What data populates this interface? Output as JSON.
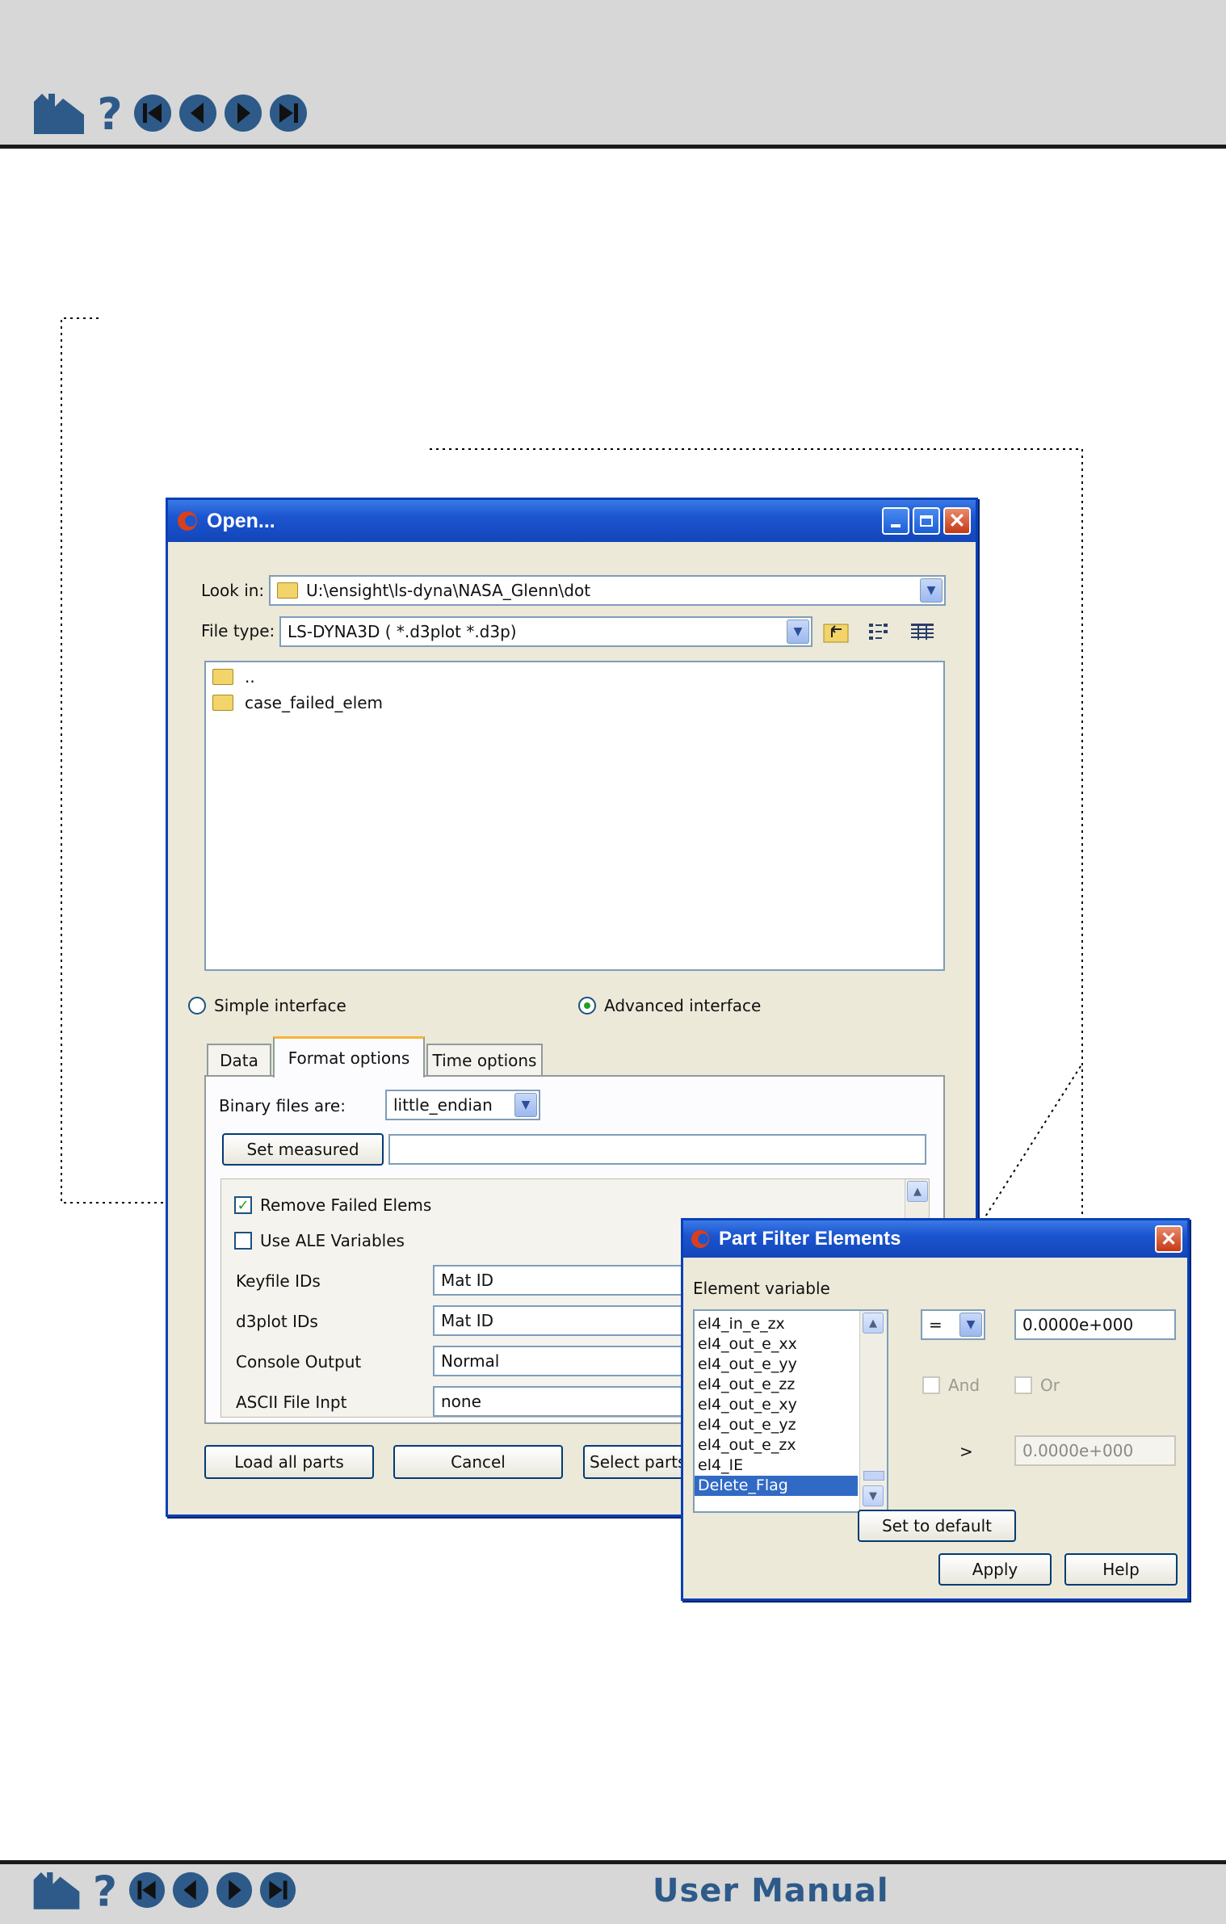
{
  "colors": {
    "bar": "#d7d7d7",
    "accent": "#2d5a88",
    "titlebar": "#1c55d0",
    "selection": "#316ac5",
    "check": "#21a121"
  },
  "nav": {
    "icons": [
      "home-icon",
      "help-icon",
      "first-page-icon",
      "prev-page-icon",
      "next-page-icon",
      "last-page-icon"
    ]
  },
  "footer": {
    "title": "User Manual"
  },
  "open_dialog": {
    "title": "Open...",
    "look_in_label": "Look in:",
    "look_in_value": "U:\\ensight\\ls-dyna\\NASA_Glenn\\dot",
    "file_type_label": "File type:",
    "file_type_value": "LS-DYNA3D ( *.d3plot *.d3p)",
    "files": [
      "..",
      "case_failed_elem"
    ],
    "simple_interface": "Simple interface",
    "advanced_interface": "Advanced interface",
    "tabs": [
      "Data",
      "Format options",
      "Time options"
    ],
    "binary_label": "Binary files are:",
    "binary_value": "little_endian",
    "set_measured": "Set measured",
    "measured_value": "",
    "remove_failed": "Remove Failed Elems",
    "use_ale": "Use ALE Variables",
    "options": [
      {
        "label": "Keyfile IDs",
        "value": "Mat ID"
      },
      {
        "label": "d3plot IDs",
        "value": "Mat ID"
      },
      {
        "label": "Console Output",
        "value": "Normal"
      },
      {
        "label": "ASCII File Inpt",
        "value": "none"
      }
    ],
    "load_all": "Load all parts",
    "cancel": "Cancel",
    "select_parts": "Select parts t"
  },
  "filter_dialog": {
    "title": "Part Filter Elements",
    "element_variable_label": "Element variable",
    "variables": [
      "el4_in_e_zx",
      "el4_out_e_xx",
      "el4_out_e_yy",
      "el4_out_e_zz",
      "el4_out_e_xy",
      "el4_out_e_yz",
      "el4_out_e_zx",
      "el4_IE",
      "Delete_Flag"
    ],
    "selected_variable": "Delete_Flag",
    "operator": "=",
    "value": "0.0000e+000",
    "and_label": "And",
    "or_label": "Or",
    "gt_symbol": ">",
    "gt_value": "0.0000e+000",
    "set_default": "Set to default",
    "apply": "Apply",
    "help": "Help"
  }
}
